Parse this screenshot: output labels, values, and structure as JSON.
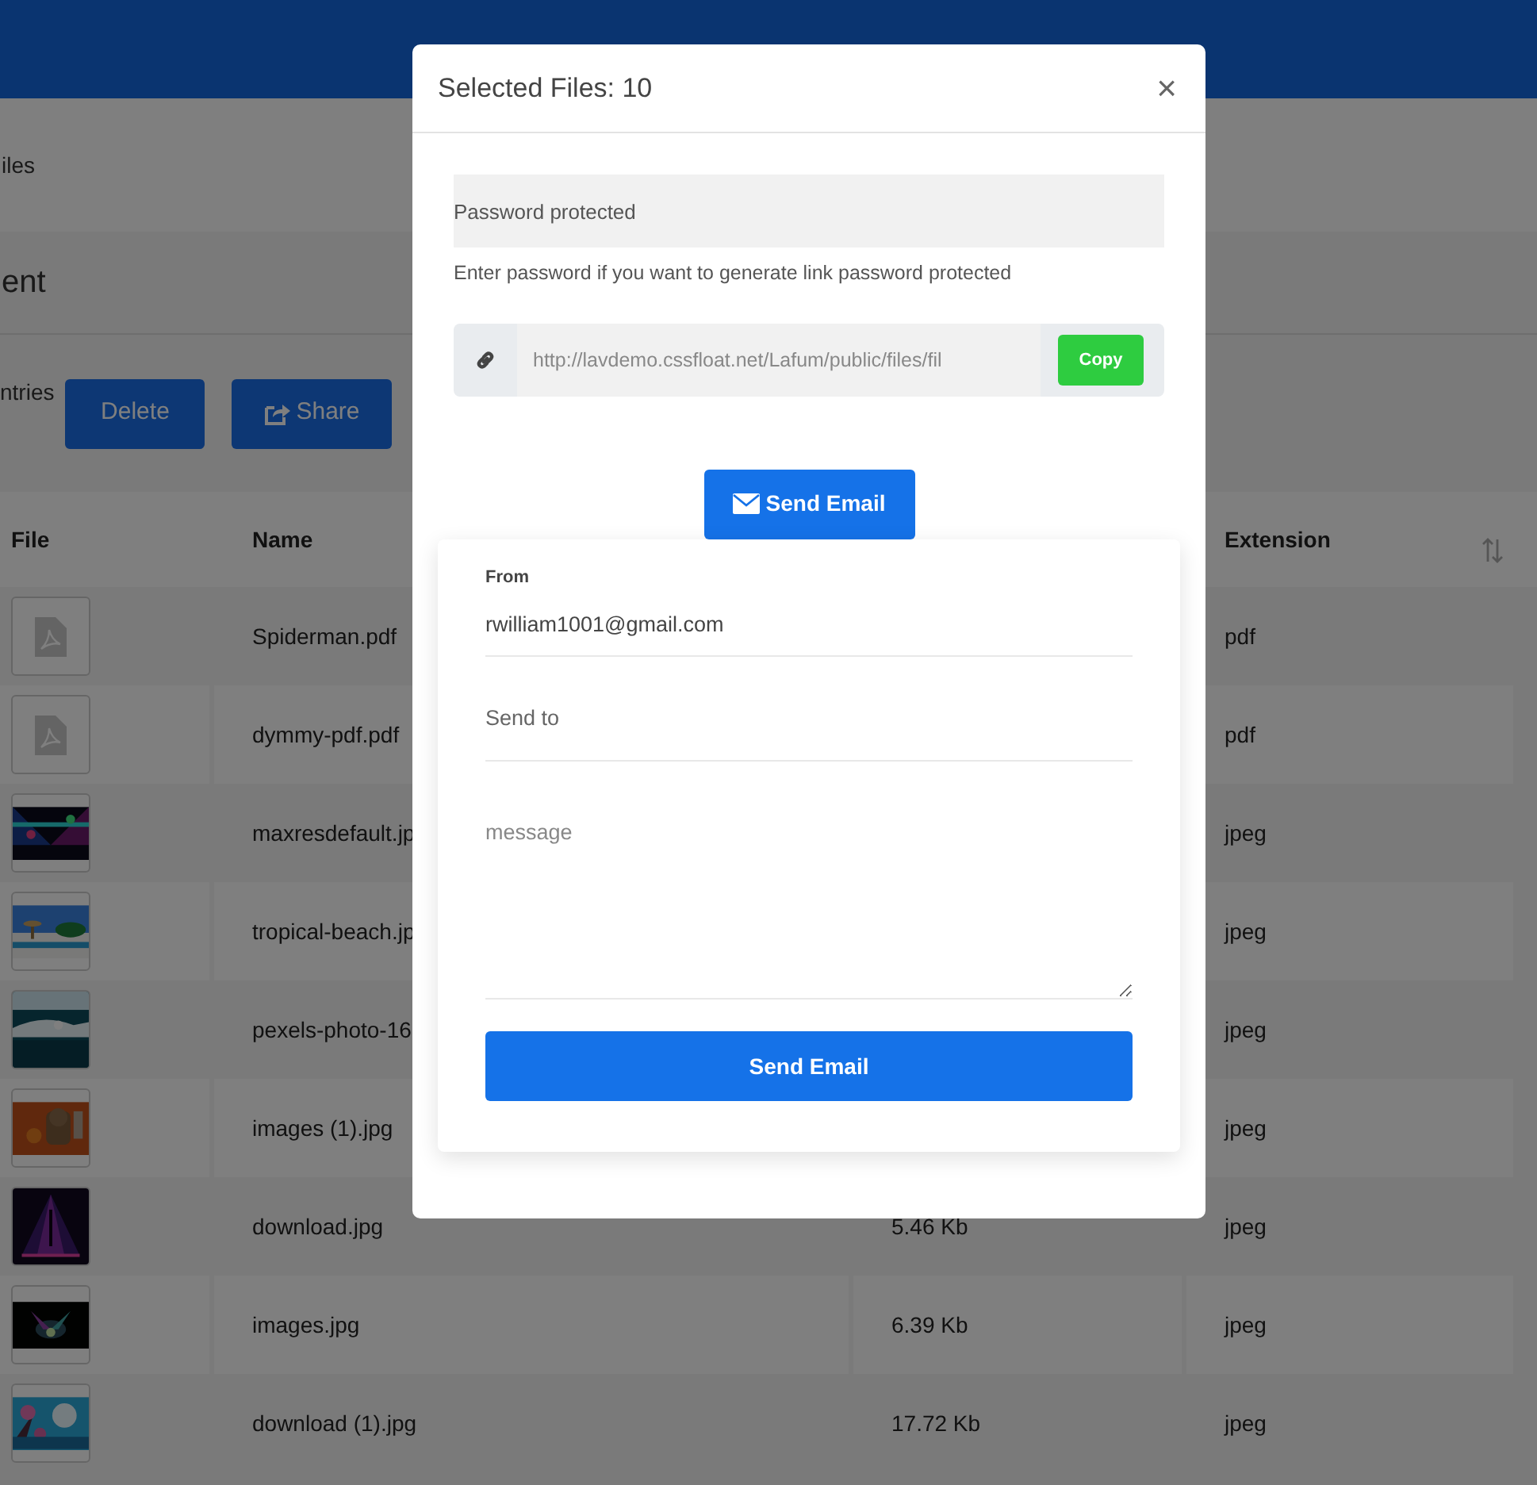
{
  "breadcrumb": "iles",
  "page_title": "ent",
  "entries_label": "ntries",
  "toolbar_buttons": [
    {
      "kind": "delete",
      "label": "Delete"
    },
    {
      "kind": "share",
      "label": "Share"
    }
  ],
  "table": {
    "columns": {
      "file": "File",
      "name": "Name",
      "extension": "Extension"
    },
    "rows": [
      {
        "kind": "pdf",
        "name": "Spiderman.pdf",
        "extension": "pdf"
      },
      {
        "kind": "pdf",
        "name": "dymmy-pdf.pdf",
        "extension": "pdf"
      },
      {
        "kind": "picture",
        "name": "maxresdefault.jp",
        "extension": "jpeg"
      },
      {
        "kind": "picture",
        "name": "tropical-beach.jp",
        "extension": "jpeg"
      },
      {
        "kind": "picture",
        "name": "pexels-photo-16",
        "extension": "jpeg"
      },
      {
        "kind": "picture",
        "name": "images (1).jpg",
        "extension": "jpeg"
      },
      {
        "kind": "picture",
        "name": "download.jpg",
        "size": "5.46 Kb",
        "extension": "jpeg"
      },
      {
        "kind": "picture",
        "name": "images.jpg",
        "size": "6.39 Kb",
        "extension": "jpeg"
      },
      {
        "kind": "picture",
        "name": "download (1).jpg",
        "size": "17.72 Kb",
        "extension": "jpeg"
      }
    ]
  },
  "modal": {
    "title": "Selected Files: 10",
    "close": "×",
    "password": {
      "placeholder": "Password protected"
    },
    "help": "Enter password if you want to generate link password protected",
    "link": {
      "value": "http://lavdemo.cssfloat.net/Lafum/public/files/fil"
    },
    "copy_button": "Copy",
    "send_toggle": "Send Email",
    "form": {
      "from_label": "From",
      "from_value": "rwilliam1001@gmail.com",
      "to_placeholder": "Send to",
      "message_placeholder": "message",
      "submit": "Send Email"
    }
  }
}
